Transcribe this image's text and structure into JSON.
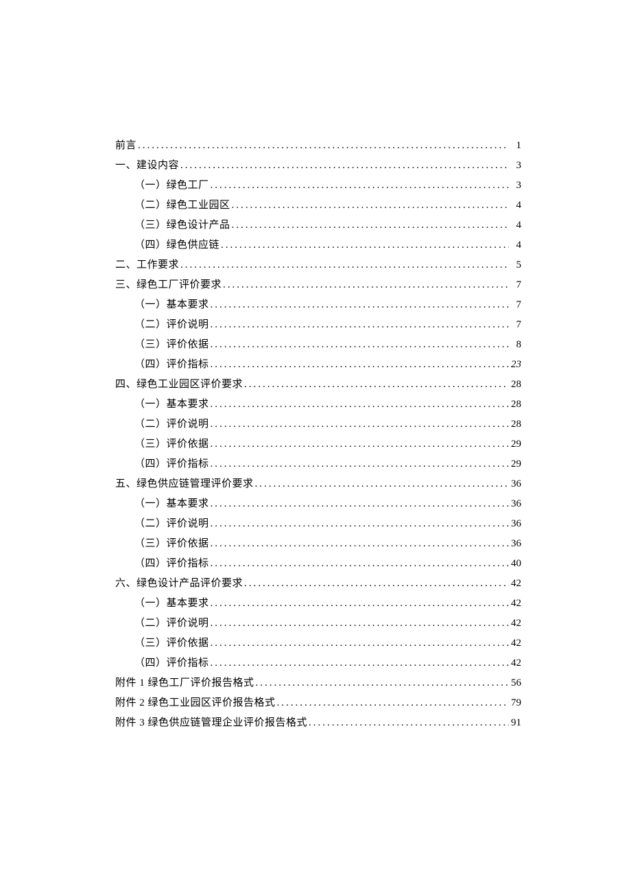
{
  "toc": [
    {
      "level": 1,
      "label": "前言",
      "page": "1",
      "italic": false
    },
    {
      "level": 1,
      "label": "一、建设内容",
      "page": "3",
      "italic": false
    },
    {
      "level": 2,
      "label": "（一）绿色工厂",
      "page": "3",
      "italic": false
    },
    {
      "level": 2,
      "label": "（二）绿色工业园区",
      "page": "4",
      "italic": false
    },
    {
      "level": 2,
      "label": "（三）绿色设计产品",
      "page": "4",
      "italic": false
    },
    {
      "level": 2,
      "label": "（四）绿色供应链",
      "page": "4",
      "italic": false
    },
    {
      "level": 1,
      "label": "二、工作要求",
      "page": "5",
      "italic": false
    },
    {
      "level": 1,
      "label": "三、绿色工厂评价要求",
      "page": "7",
      "italic": false
    },
    {
      "level": 2,
      "label": "（一）基本要求",
      "page": "7",
      "italic": false
    },
    {
      "level": 2,
      "label": "（二）评价说明",
      "page": "7",
      "italic": false
    },
    {
      "level": 2,
      "label": "（三）评价依据",
      "page": "8",
      "italic": false
    },
    {
      "level": 2,
      "label": "（四）评价指标",
      "page": "23",
      "italic": true
    },
    {
      "level": 1,
      "label": "四、绿色工业园区评价要求",
      "page": "28",
      "italic": false
    },
    {
      "level": 2,
      "label": "（一）基本要求",
      "page": "28",
      "italic": false
    },
    {
      "level": 2,
      "label": "（二）评价说明",
      "page": "28",
      "italic": false
    },
    {
      "level": 2,
      "label": "（三）评价依据",
      "page": "29",
      "italic": false
    },
    {
      "level": 2,
      "label": "（四）评价指标",
      "page": "29",
      "italic": false
    },
    {
      "level": 1,
      "label": "五、绿色供应链管理评价要求",
      "page": "36",
      "italic": false
    },
    {
      "level": 2,
      "label": "（一）基本要求",
      "page": "36",
      "italic": false
    },
    {
      "level": 2,
      "label": "（二）评价说明",
      "page": "36",
      "italic": false
    },
    {
      "level": 2,
      "label": "（三）评价依据",
      "page": "36",
      "italic": false
    },
    {
      "level": 2,
      "label": "（四）评价指标",
      "page": "40",
      "italic": false
    },
    {
      "level": 1,
      "label": "六、绿色设计产品评价要求",
      "page": "42",
      "italic": false
    },
    {
      "level": 2,
      "label": "（一）基本要求",
      "page": "42",
      "italic": false
    },
    {
      "level": 2,
      "label": "（二）评价说明",
      "page": "42",
      "italic": false
    },
    {
      "level": 2,
      "label": "（三）评价依据",
      "page": "42",
      "italic": false
    },
    {
      "level": 2,
      "label": "（四）评价指标",
      "page": "42",
      "italic": false
    },
    {
      "level": 1,
      "label": "附件 1 绿色工厂评价报告格式",
      "page": "56",
      "italic": false
    },
    {
      "level": 1,
      "label": "附件 2 绿色工业园区评价报告格式",
      "page": "79",
      "italic": false
    },
    {
      "level": 1,
      "label": "附件 3 绿色供应链管理企业评价报告格式",
      "page": "91",
      "italic": false
    }
  ]
}
